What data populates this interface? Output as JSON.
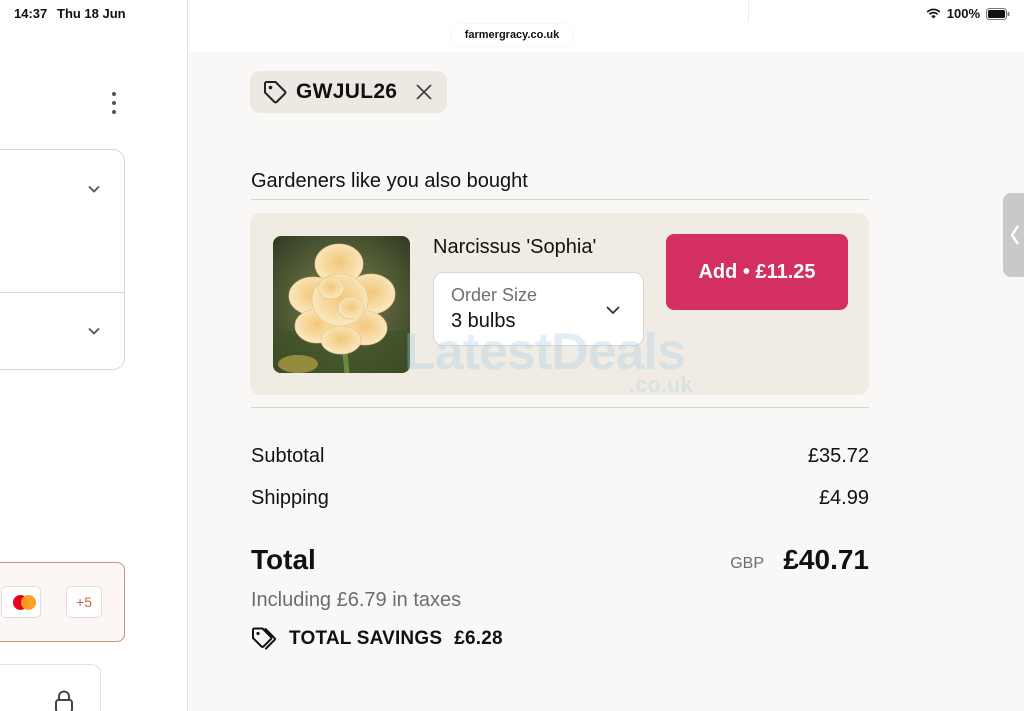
{
  "status_bar": {
    "time": "14:37",
    "date": "Thu 18 Jun",
    "battery": "100%"
  },
  "browser": {
    "url": "farmergracy.co.uk"
  },
  "left_pane": {
    "payment_more": "+5"
  },
  "discount": {
    "code": "GWJUL26"
  },
  "upsell": {
    "heading": "Gardeners like you also bought",
    "product": {
      "name": "Narcissus 'Sophia'",
      "size_label": "Order Size",
      "size_value": "3 bulbs",
      "add_label": "Add • £11.25"
    }
  },
  "summary": {
    "subtotal_label": "Subtotal",
    "subtotal_value": "£35.72",
    "shipping_label": "Shipping",
    "shipping_value": "£4.99",
    "total_label": "Total",
    "currency": "GBP",
    "total_value": "£40.71",
    "tax_note": "Including £6.79 in taxes",
    "savings_label": "TOTAL SAVINGS",
    "savings_value": "£6.28"
  },
  "watermark": {
    "text": "LatestDeals",
    "sub": ".co.uk"
  },
  "colors": {
    "accent": "#d42f61",
    "card_bg": "#f0ece4",
    "pane_bg": "#f9f8f6"
  },
  "icons": {
    "discount_tag": "tag-icon",
    "remove": "close-icon",
    "dropdown": "chevron-down-icon",
    "savings": "tags-icon",
    "wifi": "wifi-icon",
    "battery": "battery-icon",
    "lock": "lock-icon"
  }
}
